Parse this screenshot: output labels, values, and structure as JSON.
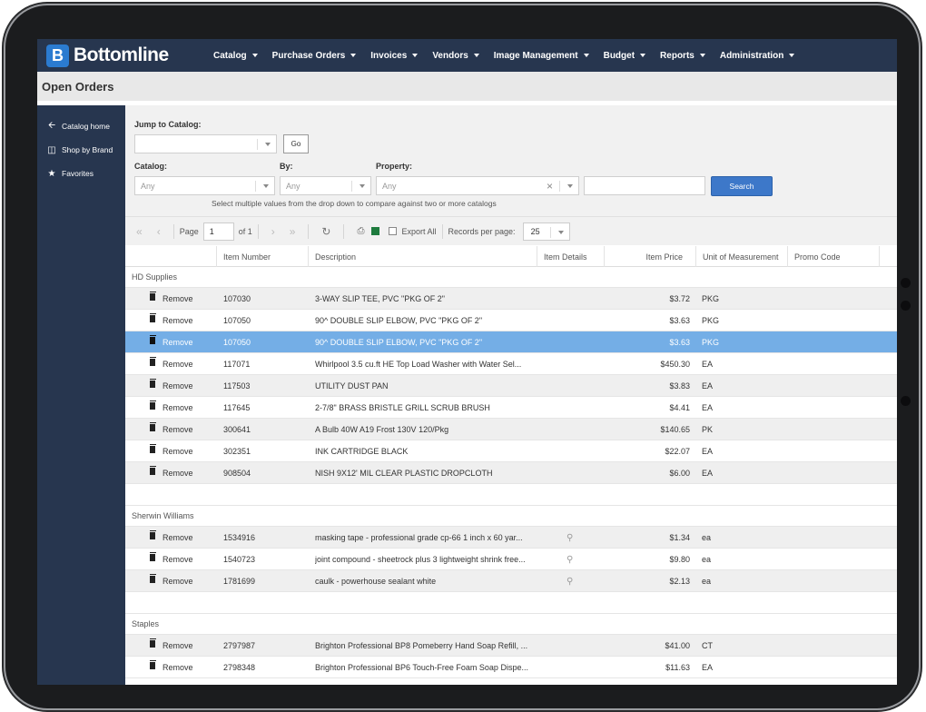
{
  "app": {
    "brand": "Bottomline",
    "brand_letter": "B"
  },
  "nav": {
    "items": [
      "Catalog",
      "Purchase Orders",
      "Invoices",
      "Vendors",
      "Image Management",
      "Budget",
      "Reports",
      "Administration"
    ]
  },
  "page": {
    "title": "Open Orders"
  },
  "sidebar": {
    "items": [
      {
        "label": "Catalog home",
        "icon": "arrow-left-icon"
      },
      {
        "label": "Shop by Brand",
        "icon": "basket-icon"
      },
      {
        "label": "Favorites",
        "icon": "star-icon"
      }
    ]
  },
  "filters": {
    "jump_label": "Jump to Catalog:",
    "go_label": "Go",
    "catalog_label": "Catalog:",
    "catalog_value": "Any",
    "by_label": "By:",
    "by_value": "Any",
    "property_label": "Property:",
    "property_value": "Any",
    "search_label": "Search",
    "hint": "Select multiple values from the drop down to compare against two or more catalogs"
  },
  "pager": {
    "page_label": "Page",
    "page_value": "1",
    "of_label": "of 1",
    "export_label": "Export All",
    "rpp_label": "Records per page:",
    "rpp_value": "25"
  },
  "table": {
    "columns": [
      "Item Number",
      "Description",
      "Item Details",
      "Item Price",
      "Unit of Measurement",
      "Promo Code"
    ],
    "remove_label": "Remove",
    "groups": [
      {
        "name": "HD Supplies",
        "rows": [
          {
            "num": "107030",
            "desc": "3-WAY SLIP TEE, PVC \"PKG OF 2\"",
            "price": "$3.72",
            "uom": "PKG"
          },
          {
            "num": "107050",
            "desc": "90^ DOUBLE SLIP ELBOW, PVC \"PKG OF 2\"",
            "price": "$3.63",
            "uom": "PKG"
          },
          {
            "num": "107050",
            "desc": "90^ DOUBLE SLIP ELBOW, PVC \"PKG OF 2\"",
            "price": "$3.63",
            "uom": "PKG"
          },
          {
            "num": "117071",
            "desc": "Whirlpool 3.5 cu.ft HE Top Load Washer with Water Sel...",
            "price": "$450.30",
            "uom": "EA"
          },
          {
            "num": "117503",
            "desc": "UTILITY DUST PAN",
            "price": "$3.83",
            "uom": "EA"
          },
          {
            "num": "117645",
            "desc": "2-7/8\" BRASS BRISTLE GRILL SCRUB BRUSH",
            "price": "$4.41",
            "uom": "EA"
          },
          {
            "num": "300641",
            "desc": "A Bulb 40W A19 Frost 130V 120/Pkg",
            "price": "$140.65",
            "uom": "PK"
          },
          {
            "num": "302351",
            "desc": "INK CARTRIDGE BLACK",
            "price": "$22.07",
            "uom": "EA"
          },
          {
            "num": "908504",
            "desc": "NISH 9X12' MIL CLEAR PLASTIC DROPCLOTH",
            "price": "$6.00",
            "uom": "EA"
          }
        ]
      },
      {
        "name": "Sherwin Williams",
        "rows": [
          {
            "num": "1534916",
            "desc": "masking tape - professional grade cp-66 1 inch x 60 yar...",
            "price": "$1.34",
            "uom": "ea"
          },
          {
            "num": "1540723",
            "desc": "joint compound - sheetrock plus 3 lightweight shrink free...",
            "price": "$9.80",
            "uom": "ea"
          },
          {
            "num": "1781699",
            "desc": "caulk - powerhouse sealant white",
            "price": "$2.13",
            "uom": "ea"
          }
        ]
      },
      {
        "name": "Staples",
        "rows": [
          {
            "num": "2797987",
            "desc": "Brighton Professional BP8 Pomeberry Hand Soap Refill, ...",
            "price": "$41.00",
            "uom": "CT"
          },
          {
            "num": "2798348",
            "desc": "Brighton Professional BP6 Touch-Free Foam Soap Dispe...",
            "price": "$11.63",
            "uom": "EA"
          }
        ]
      }
    ]
  },
  "colors": {
    "nav_bg": "#27364f",
    "selected_row": "#74aee6",
    "accent": "#3d78c9"
  }
}
